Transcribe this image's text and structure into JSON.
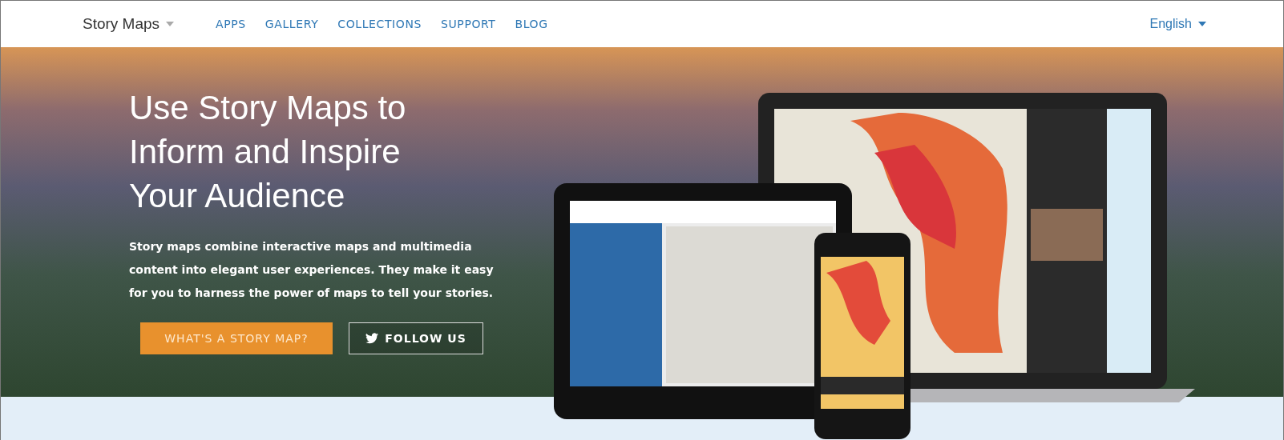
{
  "navbar": {
    "brand": "Story Maps",
    "links": [
      "APPS",
      "GALLERY",
      "COLLECTIONS",
      "SUPPORT",
      "BLOG"
    ],
    "language": "English"
  },
  "hero": {
    "title_lines": [
      "Use Story Maps to",
      "Inform and Inspire",
      "Your Audience"
    ],
    "description": "Story maps combine interactive maps and multimedia content into elegant user experiences. They make it easy for you to harness the power of maps to tell your stories.",
    "buttons": [
      {
        "kind": "primary",
        "label": "WHAT'S A STORY MAP?"
      },
      {
        "kind": "twitter",
        "label": "FOLLOW US"
      }
    ]
  }
}
